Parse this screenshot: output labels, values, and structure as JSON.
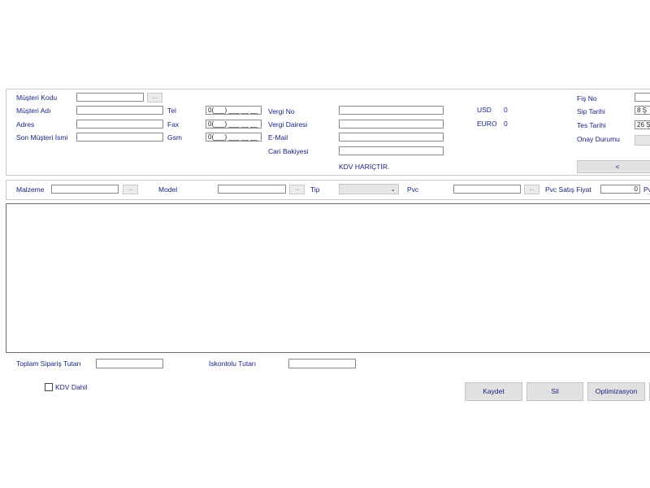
{
  "customer": {
    "kod_label": "Müşteri Kodu",
    "ad_label": "Müşteri Adı",
    "adres_label": "Adres",
    "son_label": "Son Müşteri İsmi",
    "lookup_button": "..."
  },
  "contact": {
    "tel_label": "Tel",
    "fax_label": "Fax",
    "gsm_label": "Gsm",
    "tel_value": "0(___) ___ __ __",
    "fax_value": "0(___) ___ __ __",
    "gsm_value": "0(___) ___ __ __"
  },
  "tax": {
    "vergi_no_label": "Vergi No",
    "vergi_dairesi_label": "Vergi Dairesi",
    "email_label": "E-Mail",
    "cari_label": "Cari Bakiyesi",
    "kdv_note": "KDV HARİÇTİR."
  },
  "currency": {
    "usd_label": "USD",
    "usd_value": "0",
    "euro_label": "EURO",
    "euro_value": "0"
  },
  "order": {
    "fis_label": "Fiş No",
    "sip_label": "Sip Tarihi",
    "tes_label": "Tes Tarihi",
    "onay_label": "Onay Durumu",
    "sip_value": "8 Ş",
    "tes_value": "26 Ş",
    "prev_button": "<"
  },
  "product": {
    "malzeme_label": "Malzeme",
    "model_label": "Model",
    "tip_label": "Tip",
    "pvc_label": "Pvc",
    "pvc_fiyat_label": "Pvc Satış Fiyat",
    "pvc_fiyat_value": "0",
    "trailing_label": "Pv",
    "lookup_button": "..."
  },
  "footer": {
    "toplam_label": "Toplam Sipariş Tutarı",
    "iskonto_label": "İskontolu Tutarı",
    "kdv_dahil_label": "KDV Dahil",
    "kaydet": "Kaydet",
    "sil": "Sil",
    "optimizasyon": "Optimizasyon"
  }
}
